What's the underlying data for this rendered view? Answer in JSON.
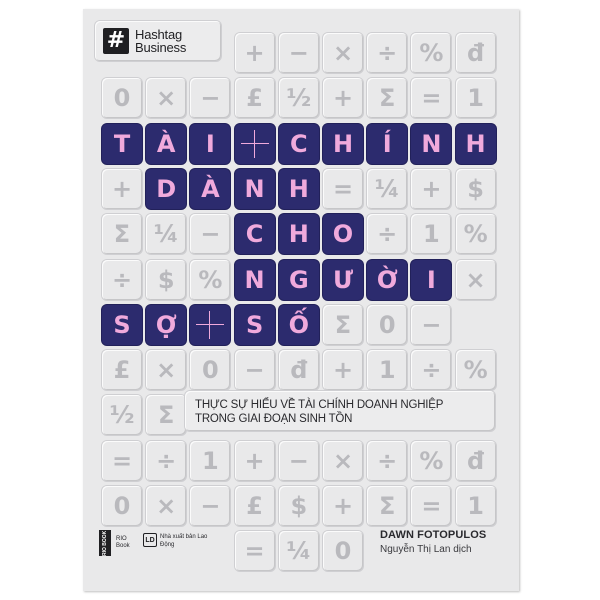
{
  "publisher_series": {
    "mark": "#",
    "line1": "Hashtag",
    "line2": "Business"
  },
  "title_rows": [
    [
      "T",
      "À",
      "I",
      "+",
      "C",
      "H",
      "Í",
      "N",
      "H"
    ],
    [
      "D",
      "À",
      "N",
      "H"
    ],
    [
      "C",
      "H",
      "O"
    ],
    [
      "N",
      "G",
      "Ư",
      "Ờ",
      "I"
    ],
    [
      "S",
      "Ợ",
      "+",
      "S",
      "Ố"
    ]
  ],
  "subtitle": {
    "line1": "THỰC SỰ HIỂU VỀ TÀI CHÍNH DOANH NGHIỆP",
    "line2": "TRONG GIAI ĐOẠN SINH TỒN"
  },
  "author": "DAWN FOTOPULOS",
  "translator": "Nguyễn Thị Lan dịch",
  "publishers": {
    "rio_mark": "RIO BOOK",
    "rio_label": "RIO Book",
    "ld_mark": "LD",
    "ld_label": "Nhà xuất bản Lao Động"
  },
  "symbol_tiles": [
    [
      "+",
      "−",
      "×",
      "÷",
      "%",
      "đ"
    ],
    [
      "0",
      "×",
      "−",
      "£",
      "½",
      "+",
      "Σ",
      "=",
      "1"
    ],
    [
      "+",
      "=",
      "¼",
      "+",
      "$"
    ],
    [
      "Σ",
      "¼",
      "−",
      "÷",
      "1",
      "%"
    ],
    [
      "÷",
      "$",
      "%",
      "×"
    ],
    [
      "=",
      "Σ",
      "0",
      "−"
    ],
    [
      "£",
      "×",
      "0",
      "−",
      "đ",
      "+",
      "1",
      "÷",
      "%"
    ],
    [
      "½",
      "Σ"
    ],
    [
      "=",
      "÷",
      "1",
      "+",
      "−",
      "×",
      "÷",
      "%",
      "đ"
    ],
    [
      "0",
      "×",
      "−",
      "£",
      "$",
      "+",
      "Σ",
      "=",
      "1"
    ],
    [
      "=",
      "¼",
      "0"
    ]
  ],
  "colors": {
    "tile_bg": "#e9e9ea",
    "title_tile": "#2c2b6e",
    "title_letter": "#f0aadc",
    "symbol": "#b9b9bd"
  }
}
